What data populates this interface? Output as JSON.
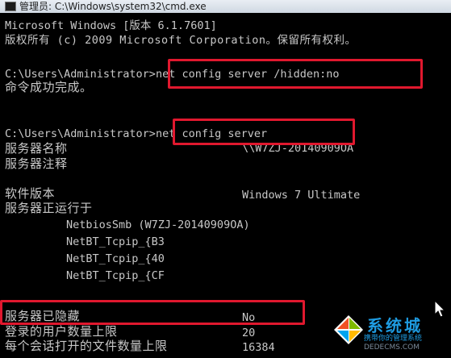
{
  "window": {
    "title": "管理员: C:\\Windows\\system32\\cmd.exe"
  },
  "console": {
    "version_line": "Microsoft Windows [版本 6.1.7601]",
    "copyright_line": "版权所有 (c) 2009 Microsoft Corporation。保留所有权利。",
    "prompt1": "C:\\Users\\Administrator>",
    "command1": "net config server /hidden:no",
    "result1": "命令成功完成。",
    "prompt2": "C:\\Users\\Administrator>",
    "command2": "net config server",
    "server_name_label": "服务器名称",
    "server_name_value": "\\\\W7ZJ-20140909OA",
    "server_comment_label": "服务器注释",
    "software_version_label": "软件版本",
    "software_version_value": "Windows 7 Ultimate",
    "server_running_label": "服务器正运行于",
    "transports": [
      "NetbiosSmb (W7ZJ-20140909OA)",
      "NetBT_Tcpip_{B3",
      "NetBT_Tcpip_{40",
      "NetBT_Tcpip_{CF"
    ],
    "server_hidden_label": "服务器已隐藏",
    "server_hidden_value": "No",
    "max_users_label": "登录的用户数量上限",
    "max_users_value": "20",
    "max_files_label": "每个会话打开的文件数量上限",
    "max_files_value": "16384"
  },
  "watermark": {
    "text": "系统城",
    "subtitle": "携带你的管理系统",
    "url": "DEDECMS.COM"
  },
  "colors": {
    "console_bg": "#000000",
    "console_text": "#c8c8c8",
    "highlight_box": "#e0182e"
  }
}
